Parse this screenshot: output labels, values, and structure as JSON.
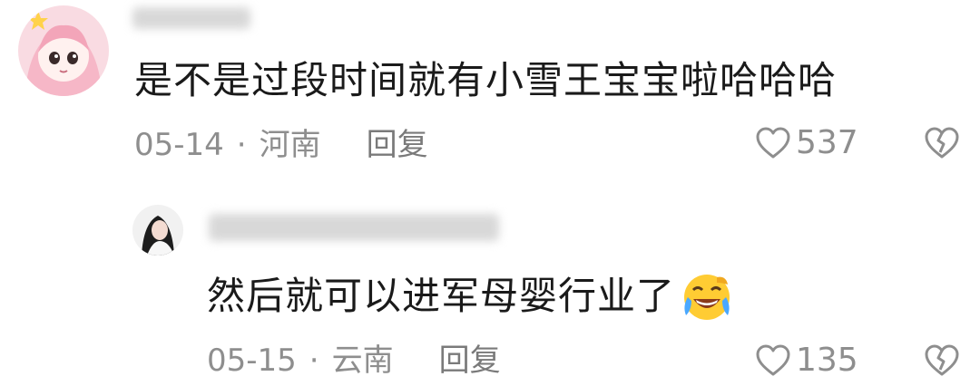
{
  "comment": {
    "text": "是不是过段时间就有小雪王宝宝啦哈哈哈",
    "date": "05-14",
    "location": "河南",
    "reply_label": "回复",
    "likes": "537",
    "separator": "·"
  },
  "reply": {
    "text": "然后就可以进军母婴行业了",
    "date": "05-15",
    "location": "云南",
    "reply_label": "回复",
    "likes": "135",
    "separator": "·",
    "emoji": "laughing-crying-emoji"
  },
  "icons": {
    "like": "heart-outline-icon",
    "dislike": "broken-heart-icon"
  },
  "colors": {
    "text": "#1a1a1a",
    "meta": "#8e8e8e",
    "icon": "#8e8e8e"
  }
}
